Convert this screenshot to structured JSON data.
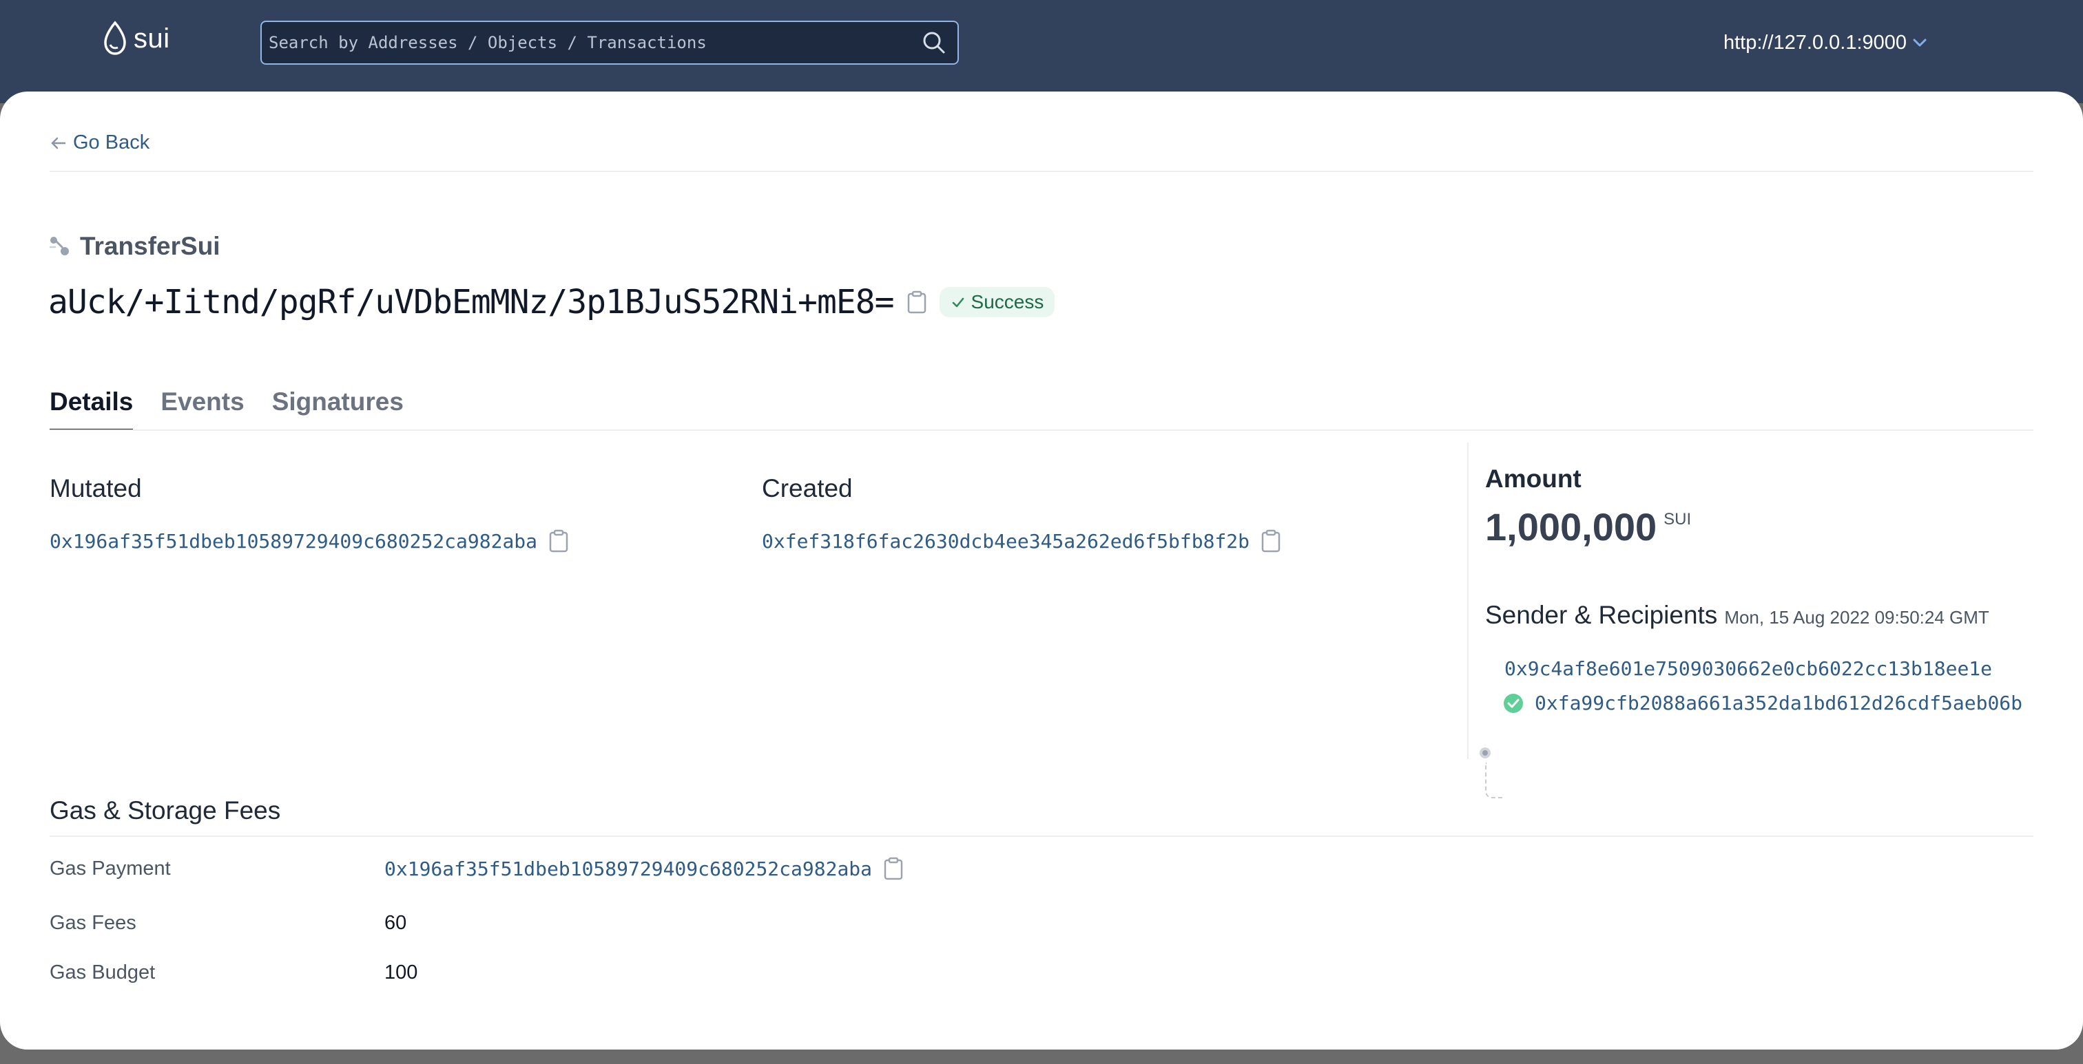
{
  "header": {
    "logo_text": "sui",
    "search": {
      "placeholder": "Search by Addresses / Objects / Transactions"
    },
    "network": "http://127.0.0.1:9000"
  },
  "nav": {
    "back_label": "Go Back"
  },
  "transaction": {
    "type": "TransferSui",
    "digest": "aUck/+Iitnd/pgRf/uVDbEmMNz/3p1BJuS52RNi+mE8=",
    "status": "Success"
  },
  "tabs": [
    {
      "label": "Details",
      "active": true
    },
    {
      "label": "Events",
      "active": false
    },
    {
      "label": "Signatures",
      "active": false
    }
  ],
  "mutated": {
    "title": "Mutated",
    "address": "0x196af35f51dbeb10589729409c680252ca982aba"
  },
  "created": {
    "title": "Created",
    "address": "0xfef318f6fac2630dcb4ee345a262ed6f5bfb8f2b"
  },
  "amount": {
    "label": "Amount",
    "value": "1,000,000",
    "unit": "SUI"
  },
  "sender_recipients": {
    "title": "Sender & Recipients",
    "date": "Mon, 15 Aug 2022 09:50:24 GMT",
    "sender": "0x9c4af8e601e7509030662e0cb6022cc13b18ee1e",
    "recipient": "0xfa99cfb2088a661a352da1bd612d26cdf5aeb06b"
  },
  "gas": {
    "title": "Gas & Storage Fees",
    "rows": [
      {
        "label": "Gas Payment",
        "value": "0x196af35f51dbeb10589729409c680252ca982aba"
      },
      {
        "label": "Gas Fees",
        "value": "60"
      },
      {
        "label": "Gas Budget",
        "value": "100"
      }
    ]
  },
  "colors": {
    "header_bg": "#33425c",
    "link": "#2f5b84",
    "success_bg": "#e9f7f0",
    "success_text": "#1b6b46"
  }
}
